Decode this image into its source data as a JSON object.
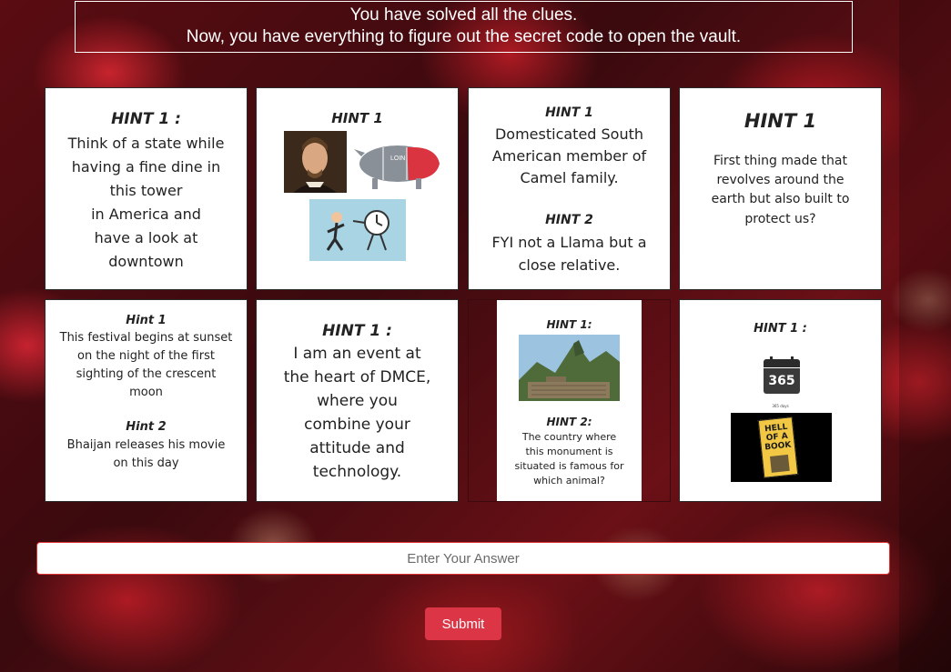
{
  "banner": {
    "line1": "You have solved all the clues.",
    "line2": "Now, you have everything to figure out the secret code to open the vault."
  },
  "cards": [
    {
      "heading": "HINT 1 :",
      "lines": [
        "Think of a state while",
        "having a fine dine in",
        "this tower",
        "in America and",
        "have a look at",
        "downtown"
      ]
    },
    {
      "heading": "HINT 1",
      "images": [
        "shakespeare-portrait",
        "pig-cuts-diagram",
        "man-running-from-clock"
      ],
      "pig_label": "LOIN"
    },
    {
      "heading": "HINT 1",
      "lines": [
        "Domesticated South",
        "American member of",
        "Camel family."
      ],
      "heading2": "HINT 2",
      "lines2": [
        "FYI not a Llama but a",
        "close relative."
      ]
    },
    {
      "heading": "HINT 1",
      "lines": [
        "First thing made that",
        "revolves around the",
        "earth but also built to",
        "protect us?"
      ]
    },
    {
      "heading": "Hint 1",
      "lines": [
        "This festival begins at sunset",
        "on the night of the first",
        "sighting of the crescent",
        "moon"
      ],
      "heading2": "Hint 2",
      "lines2": [
        "Bhaijan releases his movie",
        "on this day"
      ]
    },
    {
      "heading": "HINT 1 :",
      "lines": [
        "I am an event at",
        "the heart of DMCE,",
        "where you",
        "combine your",
        "attitude and",
        "technology."
      ]
    },
    {
      "heading": "HINT 1:",
      "images": [
        "machu-picchu-photo"
      ],
      "heading2": "HINT 2:",
      "lines2": [
        "The country where",
        "this monument is",
        "situated is famous for",
        "which animal?"
      ]
    },
    {
      "heading": "HINT 1 :",
      "calendar_number": "365",
      "calendar_caption": "365 days",
      "book_title": [
        "HELL",
        "OF A",
        "BOOK"
      ]
    }
  ],
  "form": {
    "answer_placeholder": "Enter Your Answer",
    "submit_label": "Submit"
  },
  "colors": {
    "accent": "#dc3545",
    "card": "#ffffff",
    "banner_border": "#ffffff"
  }
}
